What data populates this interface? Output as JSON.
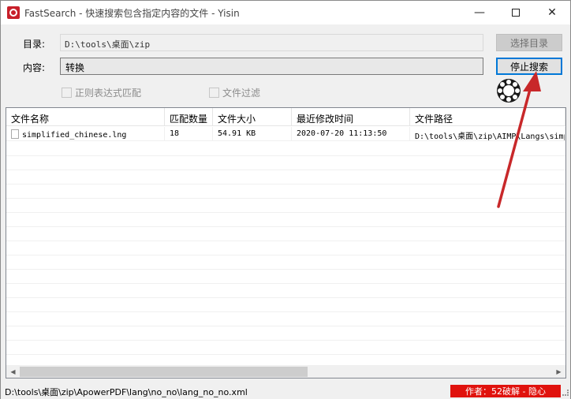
{
  "window": {
    "title": "FastSearch - 快速搜索包含指定内容的文件 - Yisin",
    "min_glyph": "—",
    "close_glyph": "✕"
  },
  "form": {
    "dir_label": "目录:",
    "dir_value": "D:\\tools\\桌面\\zip",
    "select_dir_label": "选择目录",
    "content_label": "内容:",
    "content_value": "转换",
    "stop_search_label": "停止搜索",
    "regex_label": "正则表达式匹配",
    "filter_label": "文件过滤"
  },
  "table": {
    "columns": [
      "文件名称",
      "匹配数量",
      "文件大小",
      "最近修改时间",
      "文件路径"
    ],
    "rows": [
      {
        "name": "simplified_chinese.lng",
        "matches": "18",
        "size": "54.91 KB",
        "modified": "2020-07-20 11:13:50",
        "path": "D:\\tools\\桌面\\zip\\AIMP\\Langs\\simplified_chinese.lng"
      }
    ]
  },
  "status": {
    "path": "D:\\tools\\桌面\\zip\\ApowerPDF\\lang\\no_no\\lang_no_no.xml",
    "badge": "作者：52破解 - 隐心"
  },
  "colors": {
    "accent": "#0078d7",
    "badge": "#e0120d",
    "arrow": "#c8282a",
    "app_icon": "#c8202a"
  }
}
